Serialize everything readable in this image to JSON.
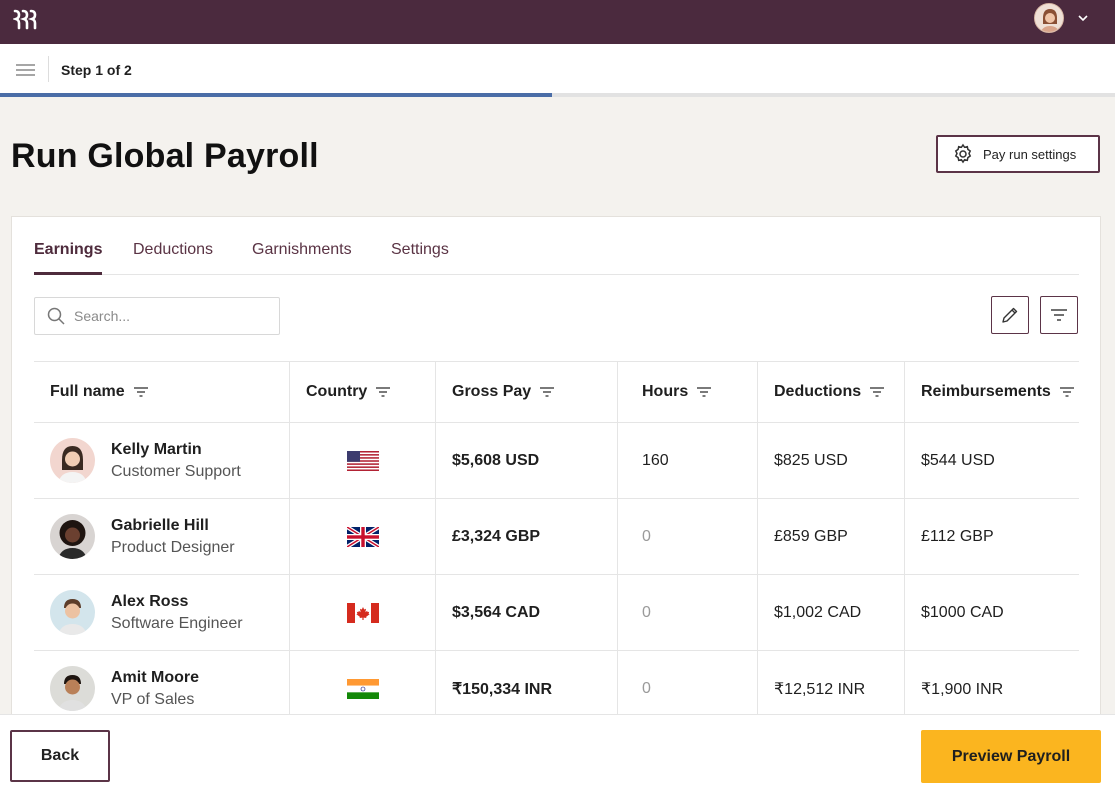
{
  "header": {
    "brand_icon": "rippling-logo",
    "profile_icon": "user-avatar",
    "menu_chevron_icon": "chevron-down-icon"
  },
  "stepbar": {
    "step_text": "Step 1 of 2",
    "progress_fraction": 0.495
  },
  "page": {
    "title": "Run Global Payroll",
    "settings_button": "Pay run settings"
  },
  "tabs": [
    {
      "label": "Earnings",
      "active": true
    },
    {
      "label": "Deductions",
      "active": false
    },
    {
      "label": "Garnishments",
      "active": false
    },
    {
      "label": "Settings",
      "active": false
    }
  ],
  "search": {
    "placeholder": "Search..."
  },
  "table": {
    "columns": [
      "Full name",
      "Country",
      "Gross Pay",
      "Hours",
      "Deductions",
      "Reimbursements"
    ],
    "rows": [
      {
        "name": "Kelly Martin",
        "role": "Customer Support",
        "country": "us-flag",
        "gross": "$5,608 USD",
        "hours": "160",
        "deductions": "$825 USD",
        "reimbursements": "$544 USD"
      },
      {
        "name": "Gabrielle Hill",
        "role": "Product Designer",
        "country": "uk-flag",
        "gross": "£3,324 GBP",
        "hours": "0",
        "deductions": "£859 GBP",
        "reimbursements": "£112 GBP"
      },
      {
        "name": "Alex Ross",
        "role": "Software Engineer",
        "country": "canada-flag",
        "gross": "$3,564 CAD",
        "hours": "0",
        "deductions": "$1,002 CAD",
        "reimbursements": "$1000 CAD"
      },
      {
        "name": "Amit Moore",
        "role": "VP of Sales",
        "country": "india-flag",
        "gross": "₹150,334 INR",
        "hours": "0",
        "deductions": "₹12,512 INR",
        "reimbursements": "₹1,900 INR"
      }
    ]
  },
  "footer": {
    "back_label": "Back",
    "preview_label": "Preview Payroll"
  },
  "colors": {
    "topbar": "#4b2a3e",
    "accent": "#5b3447",
    "progress": "#4a6da7",
    "primary_button": "#fbb51f"
  }
}
